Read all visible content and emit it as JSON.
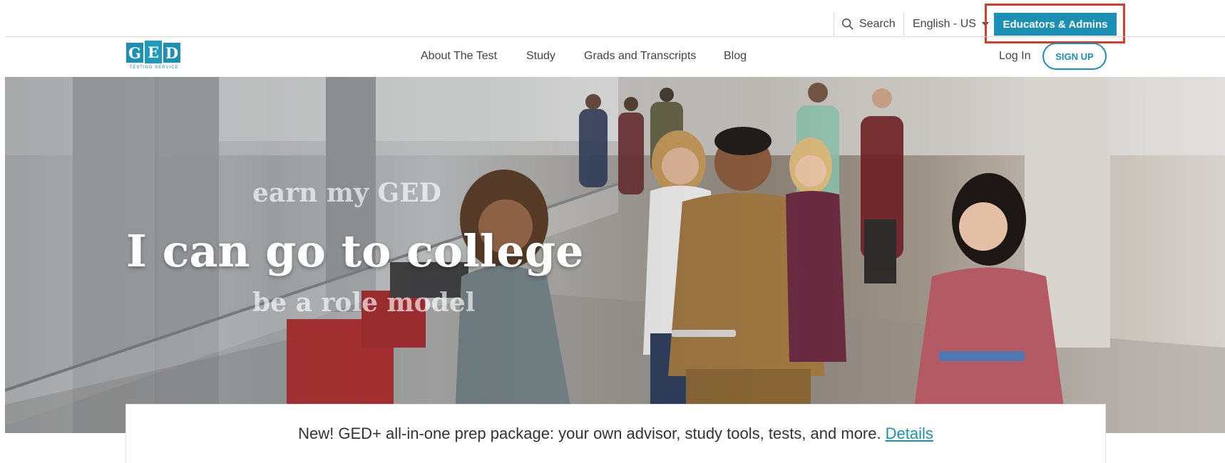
{
  "utility": {
    "search_label": "Search",
    "language_label": "English - US",
    "educators_label": "Educators & Admins"
  },
  "nav": {
    "logo": {
      "letters": [
        "G",
        "E",
        "D"
      ],
      "tagline": "TESTING SERVICE"
    },
    "links": [
      {
        "label": "About The Test"
      },
      {
        "label": "Study"
      },
      {
        "label": "Grads and Transcripts"
      },
      {
        "label": "Blog"
      }
    ],
    "login_label": "Log In",
    "signup_label": "SIGN UP"
  },
  "hero": {
    "line_top": "earn my GED",
    "line_main": "I can go to college",
    "line_bottom": "be a role model"
  },
  "announcement": {
    "text": "New! GED+ all-in-one prep package: your own advisor, study tools, tests, and more.",
    "link_label": "Details"
  },
  "colors": {
    "brand": "#1b8fb4",
    "highlight": "#d93a2b"
  }
}
